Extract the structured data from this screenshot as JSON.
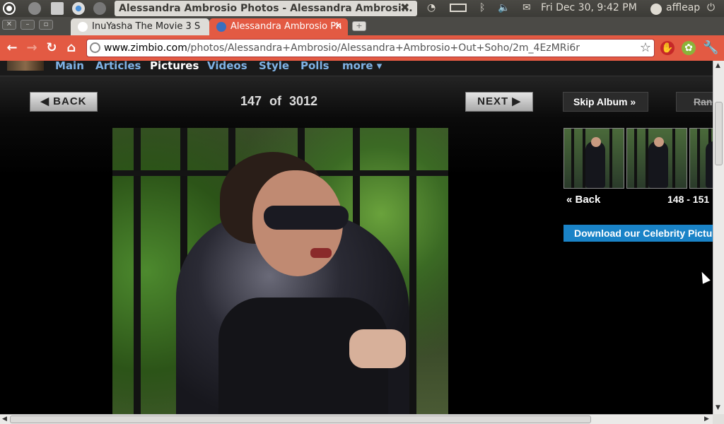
{
  "panel": {
    "window_title": "Alessandra Ambrosio Photos - Alessandra Ambrosi...",
    "clock": "Fri Dec 30,  9:42 PM",
    "user": "affleap"
  },
  "tabs": [
    {
      "label": "InuYasha The Movie 3 S",
      "active": false
    },
    {
      "label": "Alessandra Ambrosio Ph",
      "active": true
    }
  ],
  "omnibox": {
    "host": "www.zimbio.com",
    "path": "/photos/Alessandra+Ambrosio/Alessandra+Ambrosio+Out+Soho/2m_4EzMRi6r"
  },
  "sitenav": {
    "items": [
      "Main",
      "Articles",
      "Pictures",
      "Videos",
      "Style",
      "Polls",
      "more ▾"
    ],
    "current": "Pictures"
  },
  "viewer": {
    "back_label": "◀  BACK",
    "next_label": "NEXT  ▶",
    "counter": "147  of  3012"
  },
  "sidebar": {
    "skip_album": "Skip Album »",
    "random": "Ran",
    "back_label": "« Back",
    "range": "148 - 151",
    "download": "Download our Celebrity Pictu"
  },
  "colors": {
    "chrome_theme": "#e35a43",
    "nav_link": "#7fb2e5",
    "download_bg": "#1a83c7"
  }
}
